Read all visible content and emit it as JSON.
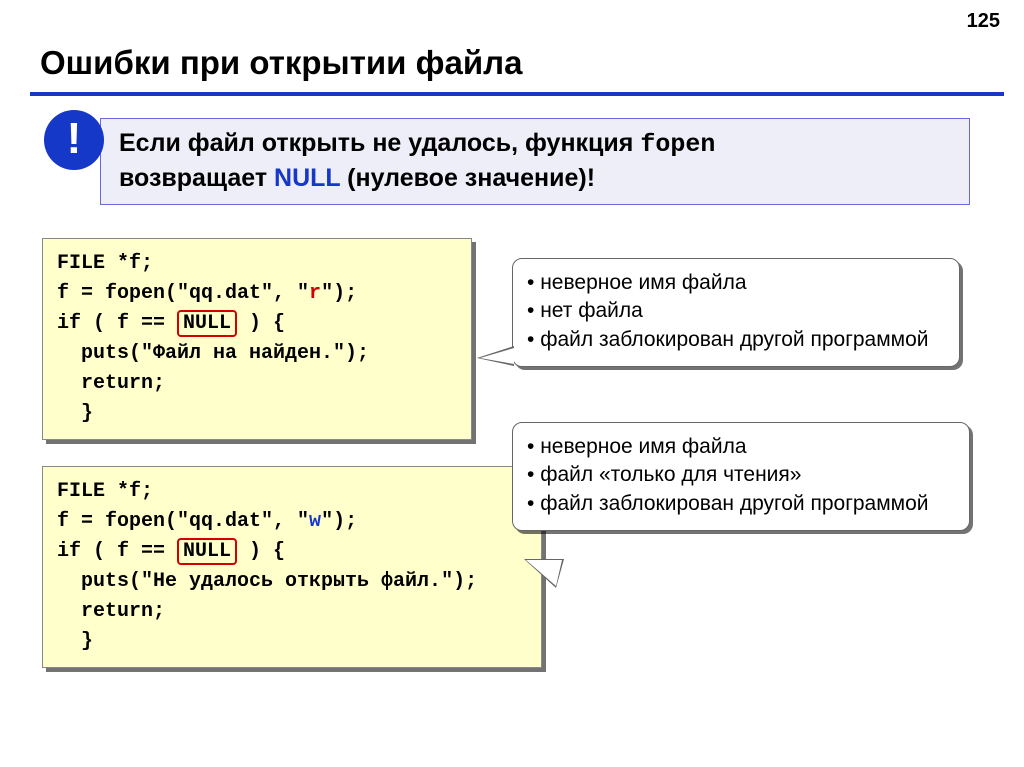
{
  "page_number": "125",
  "title": "Ошибки при открытии файла",
  "info": {
    "icon": "!",
    "text_prefix": "Если файл открыть не удалось, функция ",
    "fopen": "fopen",
    "text_mid": " возвращает ",
    "null_word": "NULL",
    "text_suffix": " (нулевое значение)!"
  },
  "code1": {
    "l1": "FILE *f;",
    "l2a": "f = fopen(\"qq.dat\", \"",
    "mode": "r",
    "l2b": "\");",
    "l3a": "if ( f == ",
    "null": "NULL",
    "l3b": " ) {",
    "l4": "  puts(\"Файл на найден.\");",
    "l5": "  return;",
    "l6": "  }"
  },
  "code2": {
    "l1": "FILE *f;",
    "l2a": "f = fopen(\"qq.dat\", \"",
    "mode": "w",
    "l2b": "\");",
    "l3a": "if ( f == ",
    "null": "NULL",
    "l3b": " ) {",
    "l4": "  puts(\"Не удалось открыть файл.\");",
    "l5": "  return;",
    "l6": "  }"
  },
  "bubble1": {
    "items": [
      "неверное имя файла",
      "нет файла",
      "файл заблокирован другой программой"
    ]
  },
  "bubble2": {
    "items": [
      "неверное имя файла",
      "файл «только для чтения»",
      "файл заблокирован другой программой"
    ]
  }
}
